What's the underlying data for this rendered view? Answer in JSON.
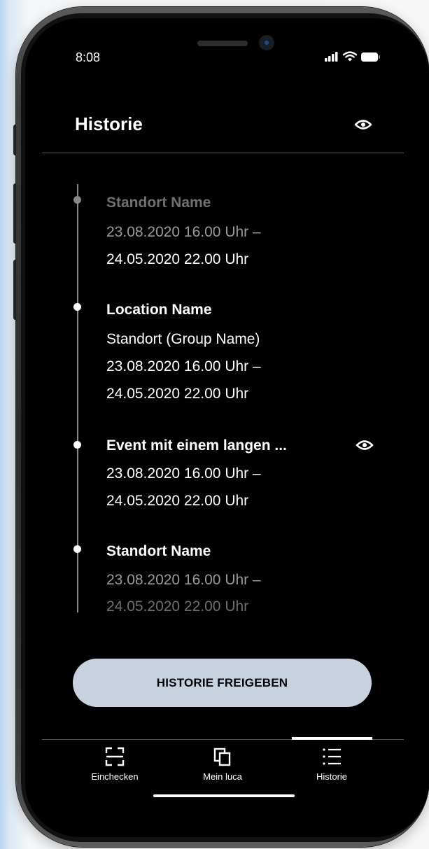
{
  "status_bar": {
    "time": "8:08"
  },
  "header": {
    "title": "Historie",
    "privacy_icon": "eye-icon"
  },
  "history": [
    {
      "title": "Standort Name",
      "lines": [
        "23.08.2020 16.00 Uhr –",
        "24.05.2020 22.00 Uhr"
      ]
    },
    {
      "title": "Location Name",
      "lines": [
        "Standort (Group Name)",
        "23.08.2020 16.00 Uhr –",
        "24.05.2020 22.00 Uhr"
      ]
    },
    {
      "title": "Event mit einem langen ...",
      "lines": [
        "23.08.2020 16.00 Uhr –",
        "24.05.2020 22.00 Uhr"
      ],
      "icon": "eye-icon"
    },
    {
      "title": "Standort Name",
      "lines": [
        "23.08.2020 16.00 Uhr –",
        "24.05.2020 22.00 Uhr"
      ]
    }
  ],
  "share_button": {
    "label": "HISTORIE FREIGEBEN",
    "color": "#c8d1de"
  },
  "nav": {
    "items": [
      {
        "label": "Einchecken",
        "icon": "scan-icon"
      },
      {
        "label": "Mein luca",
        "icon": "copy-icon"
      },
      {
        "label": "Historie",
        "icon": "list-icon"
      }
    ],
    "active_index": 2
  }
}
